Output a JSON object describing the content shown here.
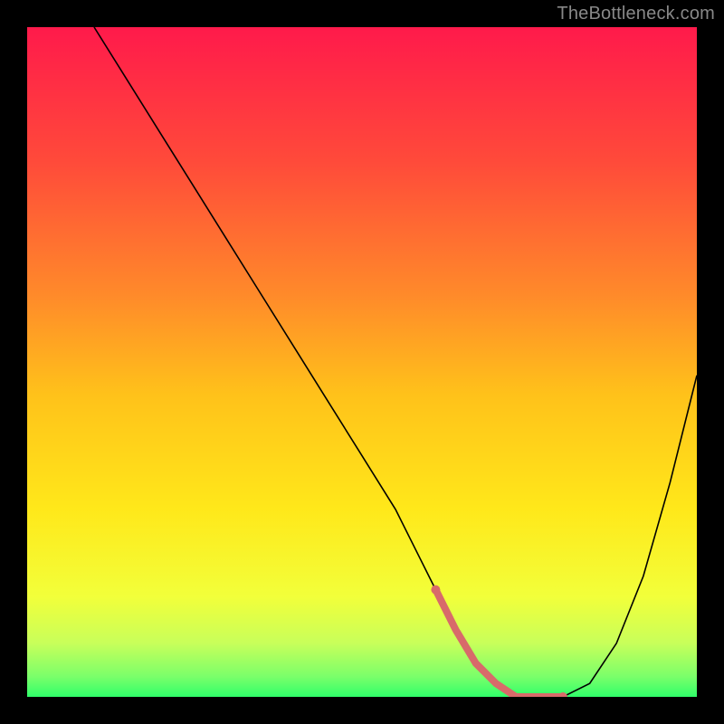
{
  "watermark": "TheBottleneck.com",
  "chart_data": {
    "type": "line",
    "title": "",
    "xlabel": "",
    "ylabel": "",
    "xlim": [
      0,
      100
    ],
    "ylim": [
      0,
      100
    ],
    "grid": false,
    "legend": false,
    "background_gradient_stops": [
      {
        "offset": 0.0,
        "color": "#ff1a4b"
      },
      {
        "offset": 0.2,
        "color": "#ff4a3a"
      },
      {
        "offset": 0.4,
        "color": "#ff8a2a"
      },
      {
        "offset": 0.55,
        "color": "#ffc21a"
      },
      {
        "offset": 0.72,
        "color": "#ffe81a"
      },
      {
        "offset": 0.85,
        "color": "#f2ff3a"
      },
      {
        "offset": 0.92,
        "color": "#c8ff5a"
      },
      {
        "offset": 0.97,
        "color": "#7aff6a"
      },
      {
        "offset": 1.0,
        "color": "#30ff6a"
      }
    ],
    "series": [
      {
        "name": "bottleneck-curve",
        "stroke": "#000000",
        "stroke_width": 1.6,
        "x": [
          10,
          15,
          20,
          25,
          30,
          35,
          40,
          45,
          50,
          55,
          58,
          61,
          64,
          67,
          70,
          73,
          76,
          80,
          84,
          88,
          92,
          96,
          100
        ],
        "values": [
          100,
          92,
          84,
          76,
          68,
          60,
          52,
          44,
          36,
          28,
          22,
          16,
          10,
          5,
          2,
          0,
          0,
          0,
          2,
          8,
          18,
          32,
          48
        ]
      }
    ],
    "highlight_segment": {
      "name": "minimum-band",
      "stroke": "#d86a6a",
      "stroke_width": 8,
      "x": [
        61,
        64,
        67,
        70,
        73,
        76,
        80
      ],
      "values": [
        16,
        10,
        5,
        2,
        0,
        0,
        0
      ]
    },
    "highlight_endpoints": [
      {
        "x": 61,
        "y": 16,
        "r": 5,
        "color": "#d86a6a"
      },
      {
        "x": 80,
        "y": 0,
        "r": 5,
        "color": "#d86a6a"
      }
    ]
  }
}
